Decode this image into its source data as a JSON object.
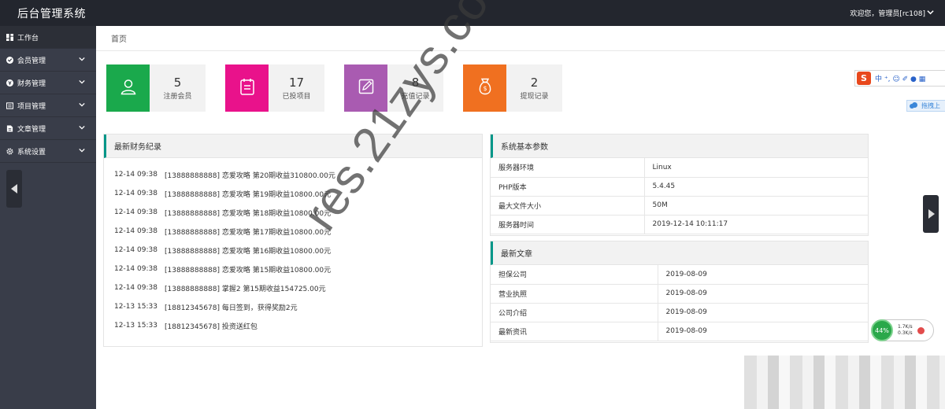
{
  "app": {
    "title": "后台管理系统",
    "user": "欢迎您，管理员[rc108]"
  },
  "sidebar": {
    "items": [
      {
        "label": "工作台",
        "icon": "dashboard-icon",
        "expandable": false
      },
      {
        "label": "会员管理",
        "icon": "member-icon",
        "expandable": true
      },
      {
        "label": "财务管理",
        "icon": "finance-icon",
        "expandable": true
      },
      {
        "label": "项目管理",
        "icon": "project-icon",
        "expandable": true
      },
      {
        "label": "文章管理",
        "icon": "article-icon",
        "expandable": true
      },
      {
        "label": "系统设置",
        "icon": "gear-icon",
        "expandable": true
      }
    ]
  },
  "breadcrumb": {
    "current": "首页"
  },
  "stats": [
    {
      "value": "5",
      "label": "注册会员",
      "color": "#1aa94c",
      "icon": "user-icon"
    },
    {
      "value": "17",
      "label": "已投项目",
      "color": "#e9128b",
      "icon": "clipboard-icon"
    },
    {
      "value": "8",
      "label": "充值记录",
      "color": "#a95bb1",
      "icon": "edit-icon"
    },
    {
      "value": "2",
      "label": "提现记录",
      "color": "#f07020",
      "icon": "money-bag-icon"
    }
  ],
  "finance": {
    "title": "最新财务纪录",
    "rows": [
      {
        "time": "12-14 09:38",
        "text": "[13888888888] 恋爱攻略 第20期收益310800.00元"
      },
      {
        "time": "12-14 09:38",
        "text": "[13888888888] 恋爱攻略 第19期收益10800.00元"
      },
      {
        "time": "12-14 09:38",
        "text": "[13888888888] 恋爱攻略 第18期收益10800.00元"
      },
      {
        "time": "12-14 09:38",
        "text": "[13888888888] 恋爱攻略 第17期收益10800.00元"
      },
      {
        "time": "12-14 09:38",
        "text": "[13888888888] 恋爱攻略 第16期收益10800.00元"
      },
      {
        "time": "12-14 09:38",
        "text": "[13888888888] 恋爱攻略 第15期收益10800.00元"
      },
      {
        "time": "12-14 09:38",
        "text": "[13888888888] 掌握2 第15期收益154725.00元"
      },
      {
        "time": "12-13 15:33",
        "text": "[18812345678] 每日签到，获得奖励2元"
      },
      {
        "time": "12-13 15:33",
        "text": "[18812345678] 投资送红包"
      }
    ]
  },
  "system": {
    "title": "系统基本参数",
    "rows": [
      {
        "key": "服务器环境",
        "value": "Linux"
      },
      {
        "key": "PHP版本",
        "value": "5.4.45"
      },
      {
        "key": "最大文件大小",
        "value": "50M"
      },
      {
        "key": "服务器时间",
        "value": "2019-12-14 10:11:17"
      }
    ]
  },
  "articles": {
    "title": "最新文章",
    "rows": [
      {
        "name": "担保公司",
        "date": "2019-08-09"
      },
      {
        "name": "营业执照",
        "date": "2019-08-09"
      },
      {
        "name": "公司介绍",
        "date": "2019-08-09"
      },
      {
        "name": "最新资讯",
        "date": "2019-08-09"
      }
    ]
  },
  "overlay": {
    "ime_label": "S",
    "ime_text": "中 ⁺, ☺ ✐ ● ▦",
    "cloud_text": "拖拽上",
    "net_percent": "44%",
    "net_up": "1.7K/s",
    "net_down": "0.3K/s",
    "watermark": "res.21zys.com"
  },
  "colors": {
    "topbar": "#23262e",
    "sidebar": "#393d49",
    "accent": "#009688"
  }
}
